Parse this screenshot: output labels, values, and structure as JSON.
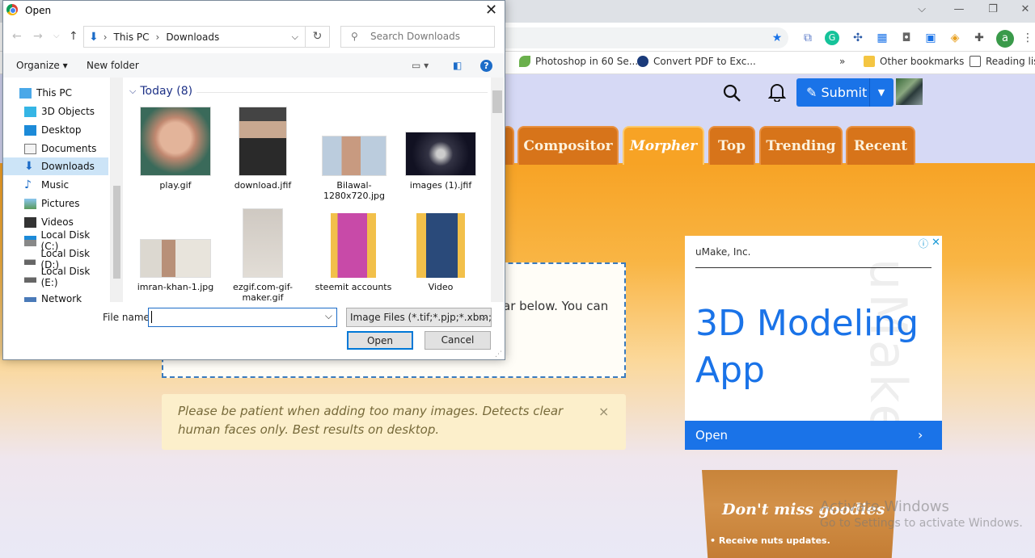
{
  "browser": {
    "bookmarks": [
      {
        "label": "Photoshop in 60 Se..."
      },
      {
        "label": "Convert PDF to Exc..."
      },
      {
        "label": "Other bookmarks"
      },
      {
        "label": "Reading list"
      }
    ],
    "more_bookmarks": "»",
    "profile_initial": "a"
  },
  "site": {
    "submit_label": "Submit",
    "tabs": [
      "Compositor",
      "Morpher",
      "Top",
      "Trending",
      "Recent"
    ],
    "active_tab": "Morpher",
    "drop_text": "ar below. You can",
    "notice": "Please be patient when adding too many images. Detects clear human faces only. Best results on desktop.",
    "notice_close": "×"
  },
  "ad": {
    "brand": "uMake, Inc.",
    "headline": "3D Modeling App",
    "button": "Open",
    "watermark": "uMake"
  },
  "goodies": {
    "title": "Don't miss goodies",
    "item": "Receive nuts updates."
  },
  "windows_watermark": {
    "line1": "Activate Windows",
    "line2": "Go to Settings to activate Windows."
  },
  "dialog": {
    "title": "Open",
    "breadcrumb": [
      "This PC",
      "Downloads"
    ],
    "search_placeholder": "Search Downloads",
    "organize": "Organize ▾",
    "new_folder": "New folder",
    "nav_items": [
      "This PC",
      "3D Objects",
      "Desktop",
      "Documents",
      "Downloads",
      "Music",
      "Pictures",
      "Videos",
      "Local Disk (C:)",
      "Local Disk (D:)",
      "Local Disk (E:)",
      "Network"
    ],
    "selected_nav": "Downloads",
    "group_header": "Today (8)",
    "files": [
      {
        "name": "play.gif"
      },
      {
        "name": "download.jfif"
      },
      {
        "name": "Bilawal-1280x720.jpg"
      },
      {
        "name": "images (1).jfif"
      },
      {
        "name": "imran-khan-1.jpg"
      },
      {
        "name": "ezgif.com-gif-maker.gif"
      },
      {
        "name": "steemit accounts"
      },
      {
        "name": "Video"
      }
    ],
    "filename_label": "File name:",
    "filename_value": "",
    "filetype": "Image Files (*.tif;*.pjp;*.xbm;*.jxl;",
    "open_button": "Open",
    "cancel_button": "Cancel"
  }
}
